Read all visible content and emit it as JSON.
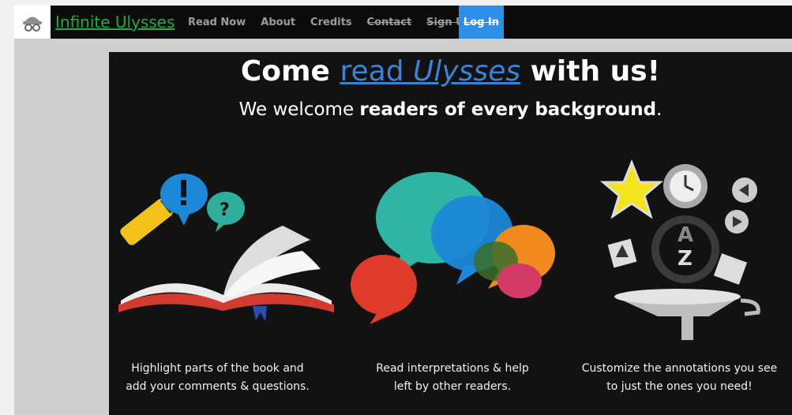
{
  "nav": {
    "brand": "Infinite Ulysses",
    "links": [
      "Read Now",
      "About",
      "Credits",
      "Contact",
      "Sign Up!"
    ],
    "login": "Log In"
  },
  "hero": {
    "headline_pre": "Come ",
    "headline_link_1": "read ",
    "headline_link_2": "Ulysses",
    "headline_post": " with us!",
    "sub_pre": "We welcome ",
    "sub_bold": "readers of every background",
    "sub_post": "."
  },
  "features": [
    {
      "icon": "highlighter-book-icon",
      "line1": "Highlight parts of the book and",
      "line2": "add your comments & questions."
    },
    {
      "icon": "speech-bubbles-icon",
      "line1": "Read interpretations & help",
      "line2": "left by other readers."
    },
    {
      "icon": "funnel-filter-icon",
      "line1": "Customize the annotations you see",
      "line2": "to just the ones you need!"
    }
  ],
  "colors": {
    "brand_green": "#27a844",
    "login_blue": "#2d8ee8",
    "link_blue": "#3b83d6",
    "hero_bg": "#121212"
  }
}
